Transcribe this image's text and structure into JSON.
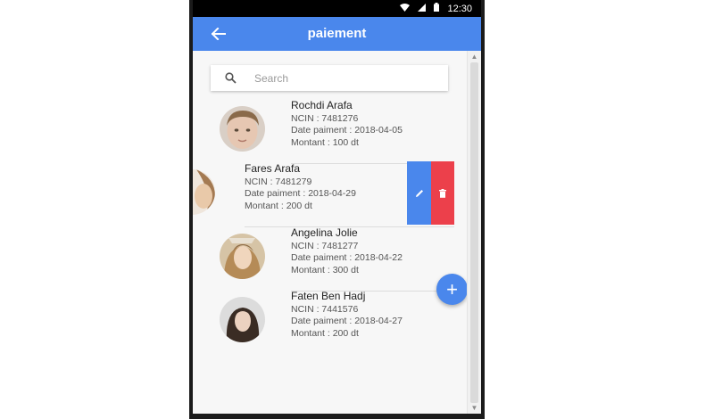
{
  "status_bar": {
    "time": "12:30",
    "icons": [
      "wifi-icon",
      "signal-icon",
      "battery-icon"
    ]
  },
  "app_bar": {
    "title": "paiement",
    "back_icon": "arrow-left-icon"
  },
  "search": {
    "placeholder": "Search",
    "value": "",
    "icon": "search-icon"
  },
  "list": [
    {
      "name": "Rochdi Arafa",
      "ncin": "NCIN : 7481276",
      "date": "Date paiment : 2018-04-05",
      "montant": "Montant : 100 dt",
      "avatar": "child-photo"
    },
    {
      "name": "Fares Arafa",
      "ncin": "NCIN : 7481279",
      "date": "Date paiment : 2018-04-29",
      "montant": "Montant : 200 dt",
      "avatar": "partial-photo",
      "swiped": true,
      "actions": {
        "edit_icon": "pencil-icon",
        "delete_icon": "trash-icon"
      }
    },
    {
      "name": "Angelina Jolie",
      "ncin": "NCIN : 7481277",
      "date": "Date paiment : 2018-04-22",
      "montant": "Montant : 300 dt",
      "avatar": "woman-photo"
    },
    {
      "name": "Faten Ben Hadj",
      "ncin": "NCIN : 7441576",
      "date": "Date paiment : 2018-04-27",
      "montant": "Montant : 200 dt",
      "avatar": "woman-photo"
    }
  ],
  "fab": {
    "icon": "plus-icon",
    "label": "+"
  },
  "colors": {
    "primary": "#4a87ec",
    "danger": "#ec404b",
    "background": "#f7f7f7"
  }
}
